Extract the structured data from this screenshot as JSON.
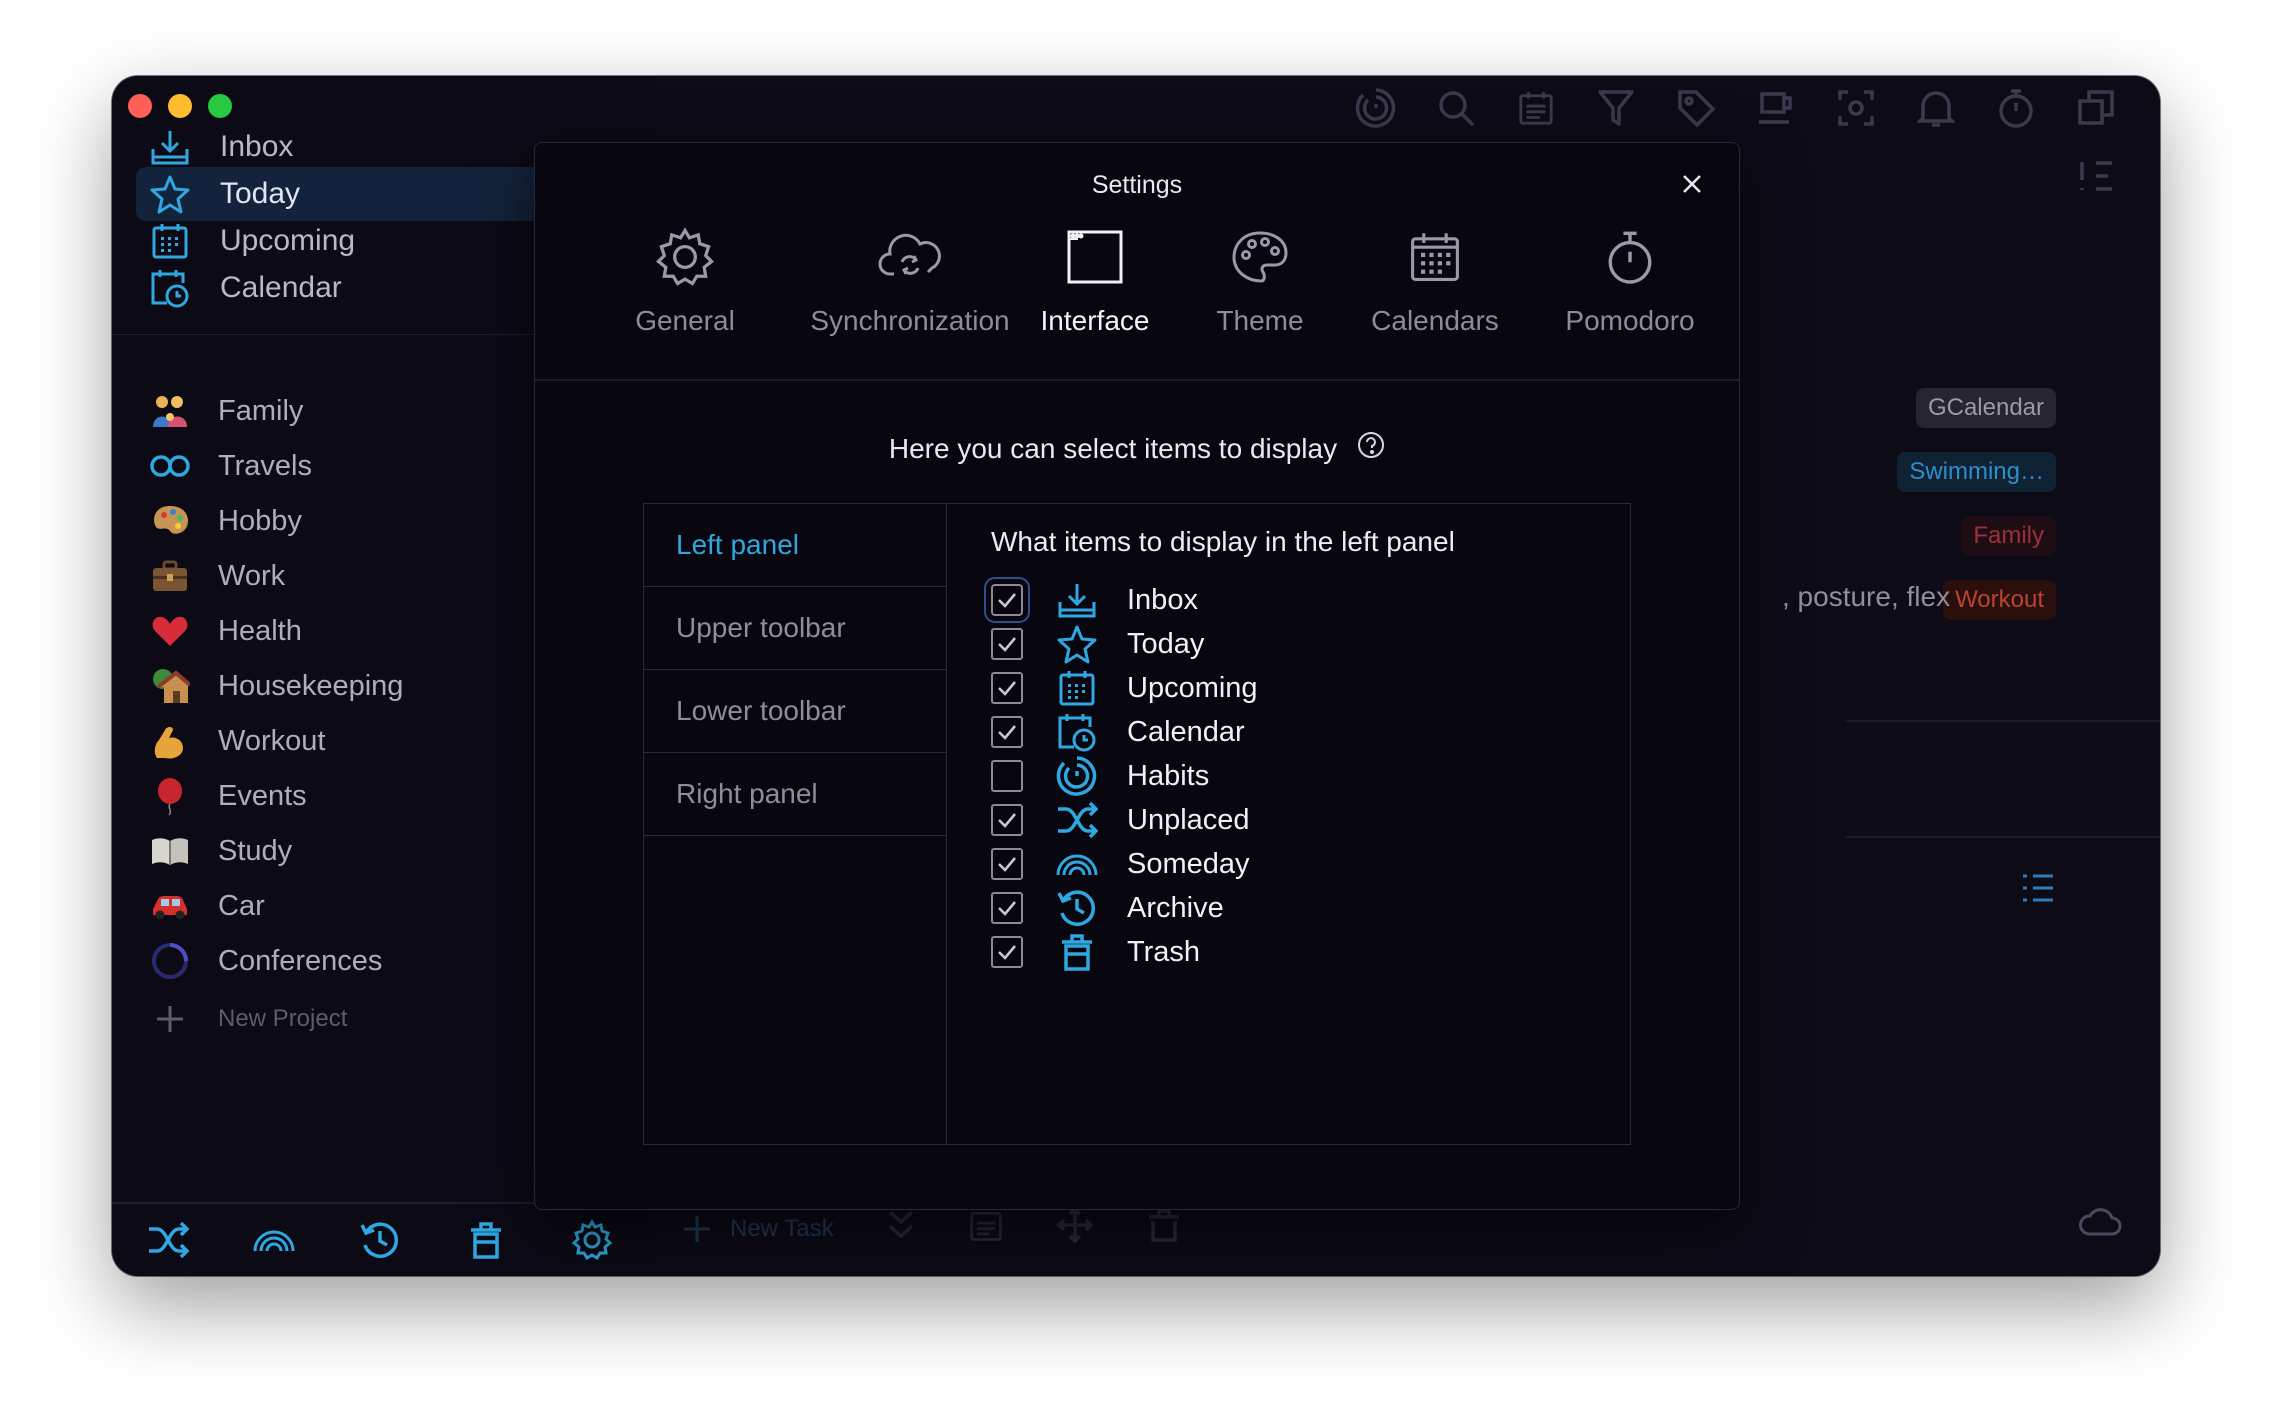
{
  "colors": {
    "accent": "#2fa7e0",
    "window_bg": "#0e0b18",
    "modal_bg": "#08060f",
    "active_nav_bg": "#13233b"
  },
  "sidebar": {
    "nav": [
      {
        "label": "Inbox",
        "icon": "inbox-icon"
      },
      {
        "label": "Today",
        "icon": "star-icon",
        "active": true
      },
      {
        "label": "Upcoming",
        "icon": "calendar-grid-icon"
      },
      {
        "label": "Calendar",
        "icon": "calendar-clock-icon"
      }
    ],
    "projects": [
      {
        "label": "Family",
        "icon": "family-emoji-icon"
      },
      {
        "label": "Travels",
        "icon": "infinity-icon"
      },
      {
        "label": "Hobby",
        "icon": "palette-emoji-icon"
      },
      {
        "label": "Work",
        "icon": "briefcase-emoji-icon"
      },
      {
        "label": "Health",
        "icon": "heart-emoji-icon"
      },
      {
        "label": "Housekeeping",
        "icon": "house-emoji-icon"
      },
      {
        "label": "Workout",
        "icon": "flexed-arm-emoji-icon"
      },
      {
        "label": "Events",
        "icon": "balloon-emoji-icon"
      },
      {
        "label": "Study",
        "icon": "book-emoji-icon"
      },
      {
        "label": "Car",
        "icon": "car-emoji-icon"
      },
      {
        "label": "Conferences",
        "icon": "ring-icon"
      }
    ],
    "new_project": "New Project"
  },
  "main": {
    "tags": [
      {
        "label": "GCalendar",
        "color": "#9a9aa8",
        "bg": "#262531"
      },
      {
        "label": "Swimming…",
        "color": "#2d8ec9",
        "bg": "#0f2234"
      },
      {
        "label": "Family",
        "color": "#9c2f3c",
        "bg": "#1f0d14"
      },
      {
        "label": "Workout",
        "color": "#b8452e",
        "bg": "#2a0f0c"
      }
    ],
    "background_text": ", posture, flex",
    "new_task": "New Task"
  },
  "settings": {
    "title": "Settings",
    "tabs": [
      {
        "label": "General",
        "icon": "gear-icon"
      },
      {
        "label": "Synchronization",
        "icon": "cloud-sync-icon"
      },
      {
        "label": "Interface",
        "icon": "window-icon",
        "active": true
      },
      {
        "label": "Theme",
        "icon": "palette-icon"
      },
      {
        "label": "Calendars",
        "icon": "calendar-grid-icon"
      },
      {
        "label": "Pomodoro",
        "icon": "stopwatch-icon"
      }
    ],
    "intro": "Here you can select items to display",
    "sections": [
      {
        "label": "Left panel",
        "active": true
      },
      {
        "label": "Upper toolbar"
      },
      {
        "label": "Lower toolbar"
      },
      {
        "label": "Right panel"
      }
    ],
    "heading": "What items to display in the left panel",
    "items": [
      {
        "label": "Inbox",
        "checked": true,
        "icon": "inbox-icon"
      },
      {
        "label": "Today",
        "checked": true,
        "icon": "star-icon"
      },
      {
        "label": "Upcoming",
        "checked": true,
        "icon": "calendar-grid-icon"
      },
      {
        "label": "Calendar",
        "checked": true,
        "icon": "calendar-clock-icon"
      },
      {
        "label": "Habits",
        "checked": false,
        "icon": "habits-icon"
      },
      {
        "label": "Unplaced",
        "checked": true,
        "icon": "shuffle-icon"
      },
      {
        "label": "Someday",
        "checked": true,
        "icon": "rainbow-icon"
      },
      {
        "label": "Archive",
        "checked": true,
        "icon": "history-icon"
      },
      {
        "label": "Trash",
        "checked": true,
        "icon": "trash-icon"
      }
    ]
  }
}
